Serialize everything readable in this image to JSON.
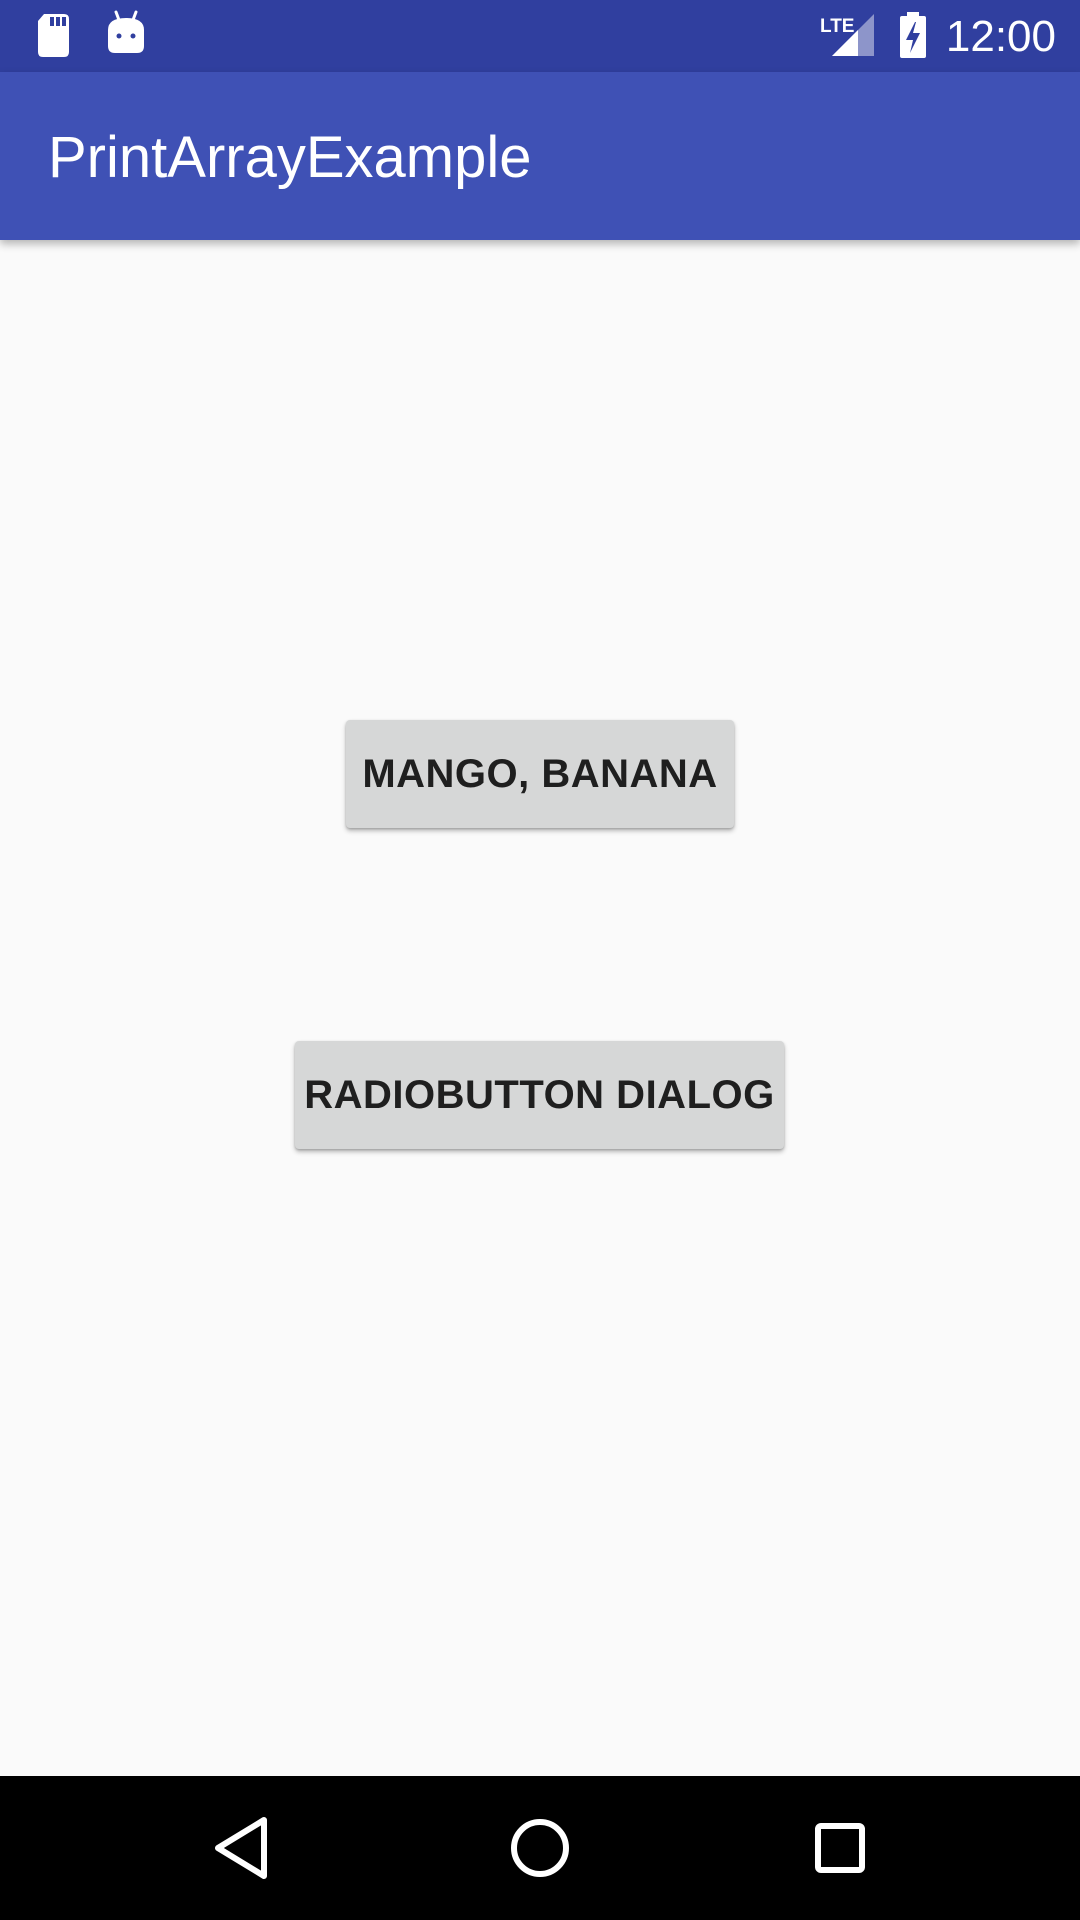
{
  "status_bar": {
    "time": "12:00",
    "network": "LTE",
    "icons": [
      "sd-card-icon",
      "android-icon",
      "lte-signal-icon",
      "battery-charging-icon"
    ],
    "background": "#303f9f"
  },
  "app_bar": {
    "title": "PrintArrayExample",
    "background": "#3f51b5"
  },
  "main": {
    "buttons": [
      {
        "label": "MANGO, BANANA"
      },
      {
        "label": "RADIOBUTTON DIALOG"
      }
    ],
    "background": "#fafafa",
    "button_color": "#d6d7d7"
  },
  "nav_bar": {
    "items": [
      "back-icon",
      "home-icon",
      "recents-icon"
    ],
    "background": "#000000"
  }
}
